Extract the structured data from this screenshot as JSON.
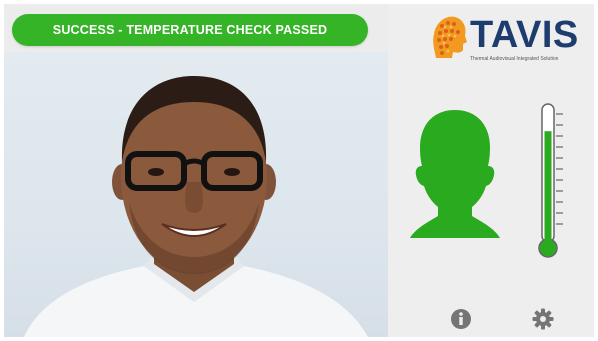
{
  "status": {
    "message": "SUCCESS - TEMPERATURE CHECK PASSED",
    "color": "#36b428"
  },
  "brand": {
    "name": "TAVIS",
    "tagline": "Thermal Audiovisual Integrated Solution",
    "color": "#1f3c6e",
    "logo_icon": "head-logo-icon"
  },
  "indicator": {
    "color": "#2aaa1e",
    "thermometer_level": 0.82
  },
  "icons": {
    "info": "info-icon",
    "settings": "gear-icon"
  }
}
